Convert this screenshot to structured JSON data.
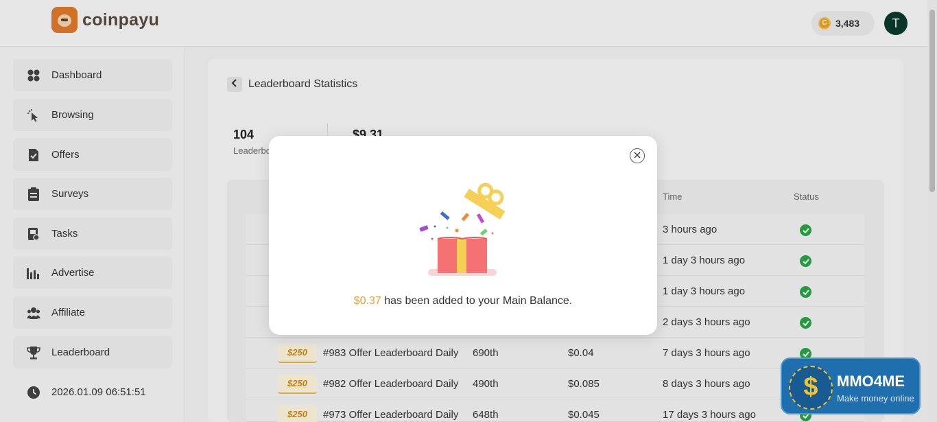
{
  "header": {
    "brand": "coinpayu",
    "coin_symbol": "C",
    "coin_balance": "3,483",
    "avatar_initial": "T"
  },
  "sidebar": {
    "items": [
      {
        "label": "Dashboard",
        "icon": "dashboard-icon"
      },
      {
        "label": "Browsing",
        "icon": "cursor-click-icon"
      },
      {
        "label": "Offers",
        "icon": "offers-icon"
      },
      {
        "label": "Surveys",
        "icon": "clipboard-icon"
      },
      {
        "label": "Tasks",
        "icon": "tasks-icon"
      },
      {
        "label": "Advertise",
        "icon": "bar-chart-icon"
      },
      {
        "label": "Affiliate",
        "icon": "users-icon"
      },
      {
        "label": "Leaderboard",
        "icon": "trophy-icon"
      }
    ],
    "datetime": "2026.01.09 06:51:51"
  },
  "main": {
    "title": "Leaderboard Statistics",
    "stats": [
      {
        "value": "104",
        "label": "Leaderbo"
      },
      {
        "value": "$9.31",
        "label": ""
      }
    ],
    "table": {
      "headers": {
        "time": "Time",
        "status": "Status"
      },
      "rows": [
        {
          "badge": "",
          "name": "",
          "rank": "",
          "reward": "",
          "time": "3 hours ago"
        },
        {
          "badge": "",
          "name": "",
          "rank": "",
          "reward": "",
          "time": "1 day 3 hours ago"
        },
        {
          "badge": "",
          "name": "",
          "rank": "",
          "reward": "",
          "time": "1 day 3 hours ago"
        },
        {
          "badge": "",
          "name": "",
          "rank": "",
          "reward": "",
          "time": "2 days 3 hours ago"
        },
        {
          "badge": "$250",
          "name": "#983 Offer Leaderboard Daily",
          "rank": "690th",
          "reward": "$0.04",
          "time": "7 days 3 hours ago"
        },
        {
          "badge": "$250",
          "name": "#982 Offer Leaderboard Daily",
          "rank": "490th",
          "reward": "$0.085",
          "time": "8 days 3 hours ago"
        },
        {
          "badge": "$250",
          "name": "#973 Offer Leaderboard Daily",
          "rank": "648th",
          "reward": "$0.045",
          "time": "17 days 3 hours ago"
        }
      ]
    }
  },
  "modal": {
    "amount": "$0.37",
    "message": " has been added to your Main Balance."
  },
  "watermark": {
    "symbol": "$",
    "title": "MMO4ME",
    "subtitle": "Make money online"
  },
  "colors": {
    "status_ok": "#28a745",
    "amount_highlight": "#e0a33a",
    "avatar": "#0b3b2d"
  }
}
